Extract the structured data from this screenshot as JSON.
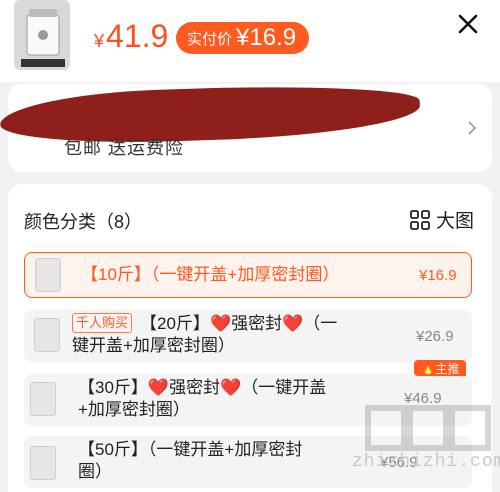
{
  "header": {
    "price_symbol": "¥",
    "price_value": "41.9",
    "real_price_label": "实付价",
    "real_price_value": "¥16.9"
  },
  "shipping": {
    "text": "包邮  送运费险"
  },
  "options": {
    "title": "颜色分类（8）",
    "bigpic_label": "大图",
    "items": [
      {
        "label": "【10斤】（一键开盖+加厚密封圈）",
        "price": "¥16.9",
        "selected": true
      },
      {
        "tag": "千人购买",
        "label_a": "【20斤】",
        "label_b": "强密封",
        "label_c": "（一",
        "label_line2": "键开盖+加厚密封圈）",
        "price": "¥26.9"
      },
      {
        "label_a": "【30斤】",
        "label_b": "强密封",
        "label_c": "（一键开盖",
        "label_line2": "+加厚密封圈）",
        "price": "¥46.9",
        "badge": "主推"
      },
      {
        "label": "【50斤】（一键开盖+加厚密封",
        "label_line2": "圈）",
        "price": "¥56.9"
      }
    ]
  },
  "watermark": {
    "text": "zhizhizhi.com"
  },
  "colors": {
    "accent": "#ff5a1f",
    "price": "#ff4e20",
    "heart": "#e22222"
  },
  "icons": [
    "close-icon",
    "chevron-right-icon",
    "grid-icon",
    "heart-icon",
    "fire-icon"
  ]
}
